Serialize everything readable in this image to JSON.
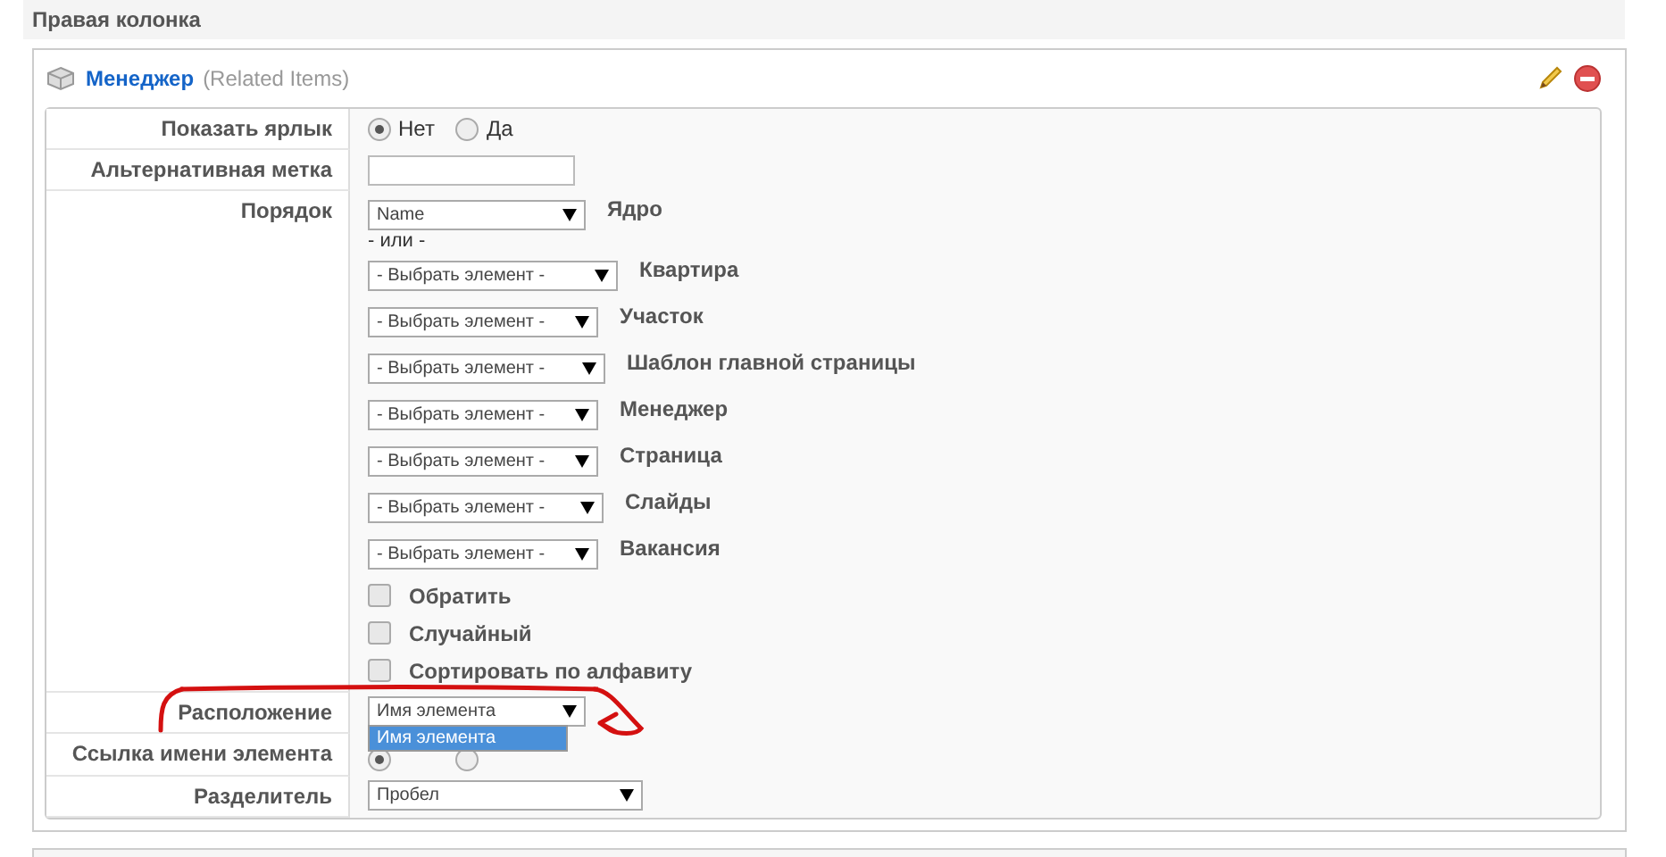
{
  "section": {
    "title": "Правая колонка"
  },
  "module": {
    "title": "Менеджер",
    "subtitle": "(Related Items)"
  },
  "rows": [
    {
      "kind": "radio",
      "label": "Показать ярлык",
      "options": [
        {
          "label": "Нет",
          "selected": true
        },
        {
          "label": "Да",
          "selected": false
        }
      ]
    },
    {
      "kind": "text",
      "label": "Альтернативная метка",
      "value": ""
    },
    {
      "kind": "order",
      "label": "Порядок",
      "primary": {
        "value": "Name",
        "label": "Ядро"
      },
      "separator": "- или -",
      "selects": [
        {
          "value": "- Выбрать элемент -",
          "label": "Квартира"
        },
        {
          "value": "- Выбрать элемент -",
          "label": "Участок"
        },
        {
          "value": "- Выбрать элемент -",
          "label": "Шаблон главной страницы"
        },
        {
          "value": "- Выбрать элемент -",
          "label": "Менеджер"
        },
        {
          "value": "- Выбрать элемент -",
          "label": "Страница"
        },
        {
          "value": "- Выбрать элемент -",
          "label": "Слайды"
        },
        {
          "value": "- Выбрать элемент -",
          "label": "Вакансия"
        }
      ],
      "checkboxes": [
        {
          "label": "Обратить",
          "checked": false
        },
        {
          "label": "Случайный",
          "checked": false
        },
        {
          "label": "Сортировать по алфавиту",
          "checked": false
        }
      ]
    },
    {
      "kind": "select",
      "label": "Расположение",
      "value": "Имя элемента",
      "expanded": true,
      "options": [
        {
          "label": "Имя элемента",
          "selected": true
        }
      ]
    },
    {
      "kind": "radio",
      "label": "Ссылка имени элемента",
      "options": [
        {
          "selected": true
        },
        {
          "selected": false
        }
      ]
    },
    {
      "kind": "select",
      "label": "Разделитель",
      "value": "Пробел",
      "expanded": false,
      "wide": true
    }
  ]
}
